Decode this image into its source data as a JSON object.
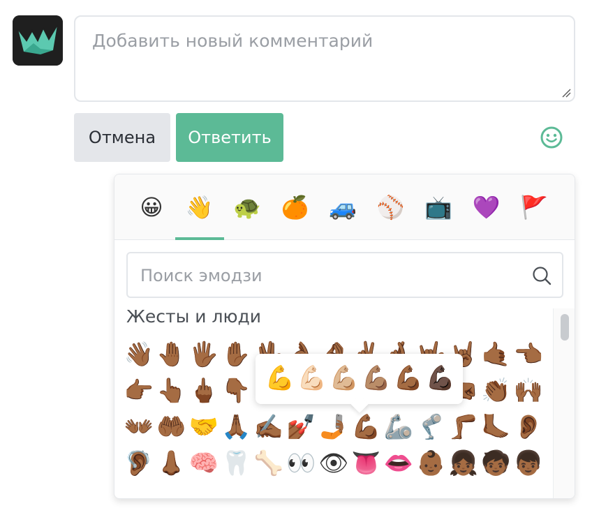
{
  "comment": {
    "placeholder": "Добавить новый комментарий"
  },
  "buttons": {
    "cancel_label": "Отмена",
    "reply_label": "Ответить"
  },
  "colors": {
    "accent": "#5cba96",
    "cancel_bg": "#e4e6ea"
  },
  "picker": {
    "tabs": [
      {
        "icon": "😀",
        "name": "smileys-tab"
      },
      {
        "icon": "👋",
        "name": "people-tab"
      },
      {
        "icon": "🐢",
        "name": "nature-tab"
      },
      {
        "icon": "🍊",
        "name": "food-tab"
      },
      {
        "icon": "🚙",
        "name": "travel-tab"
      },
      {
        "icon": "⚾",
        "name": "activities-tab"
      },
      {
        "icon": "📺",
        "name": "objects-tab"
      },
      {
        "icon": "💜",
        "name": "symbols-tab"
      },
      {
        "icon": "🚩",
        "name": "flags-tab"
      }
    ],
    "active_tab": 1,
    "search_placeholder": "Поиск эмодзи",
    "category_title": "Жесты и люди",
    "rows": [
      [
        "👋🏾",
        "🤚🏾",
        "🖐🏾",
        "✋🏾",
        "🖖🏾",
        "👌🏾",
        "🤌🏾",
        "✌🏾",
        "🤞🏾",
        "🤟🏾",
        "🤘🏾",
        "🤙🏾",
        "👈🏾"
      ],
      [
        "👉🏾",
        "👆🏾",
        "🖕🏾",
        "👇🏾",
        "☝🏾",
        "👍🏾",
        "👎🏾",
        "✊🏾",
        "👊🏾",
        "🤛🏾",
        "🤜🏾",
        "👏🏾",
        "🙌🏾"
      ],
      [
        "👐🏾",
        "🤲🏾",
        "🤝",
        "🙏🏾",
        "✍🏾",
        "💅🏾",
        "🤳🏾",
        "💪🏾",
        "🦾",
        "🦿",
        "🦵🏾",
        "🦶🏾",
        "👂🏾"
      ],
      [
        "🦻🏾",
        "👃🏾",
        "🧠",
        "🦷",
        "🦴",
        "👀",
        "👁",
        "👅",
        "👄",
        "👶🏾",
        "👧🏾",
        "🧒🏾",
        "👦🏾"
      ]
    ],
    "skin_tones": [
      "💪",
      "💪🏻",
      "💪🏼",
      "💪🏽",
      "💪🏾",
      "💪🏿"
    ]
  }
}
